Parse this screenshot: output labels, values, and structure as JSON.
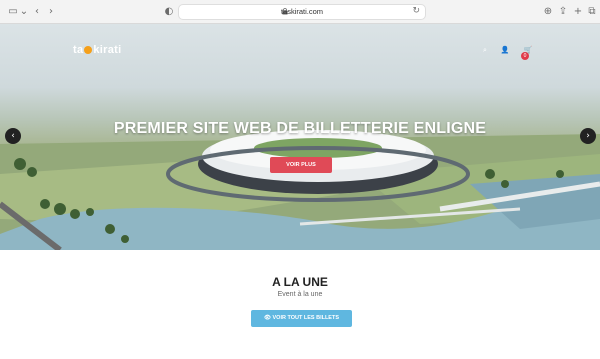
{
  "browser": {
    "url": "taskirati.com",
    "icons": {
      "sidebar": "sidebar-icon",
      "back": "chevron-left-icon",
      "forward": "chevron-right-icon",
      "privacy": "shield-icon",
      "reload": "reload-icon",
      "download": "download-icon",
      "share": "share-icon",
      "new_tab": "plus-icon",
      "tabs": "tabs-icon"
    }
  },
  "site": {
    "logo": {
      "pre": "ta",
      "post": "kirati"
    },
    "nav_icons": {
      "search": "search-icon",
      "user": "user-icon",
      "cart": "cart-icon"
    },
    "cart_count": "0",
    "colors": {
      "accent": "#f5a01a",
      "primary_button": "#e04a57",
      "secondary_button": "#5fb7e0"
    }
  },
  "hero": {
    "title": "PREMIER SITE WEB DE BILLETTERIE ENLIGNE",
    "button_label": "VOIR PLUS",
    "prev_icon": "arrow-left-icon",
    "next_icon": "arrow-right-icon"
  },
  "featured": {
    "title": "A LA UNE",
    "subtitle": "Event à la une",
    "button_label": "👁 VOIR TOUT LES BILLETS"
  }
}
